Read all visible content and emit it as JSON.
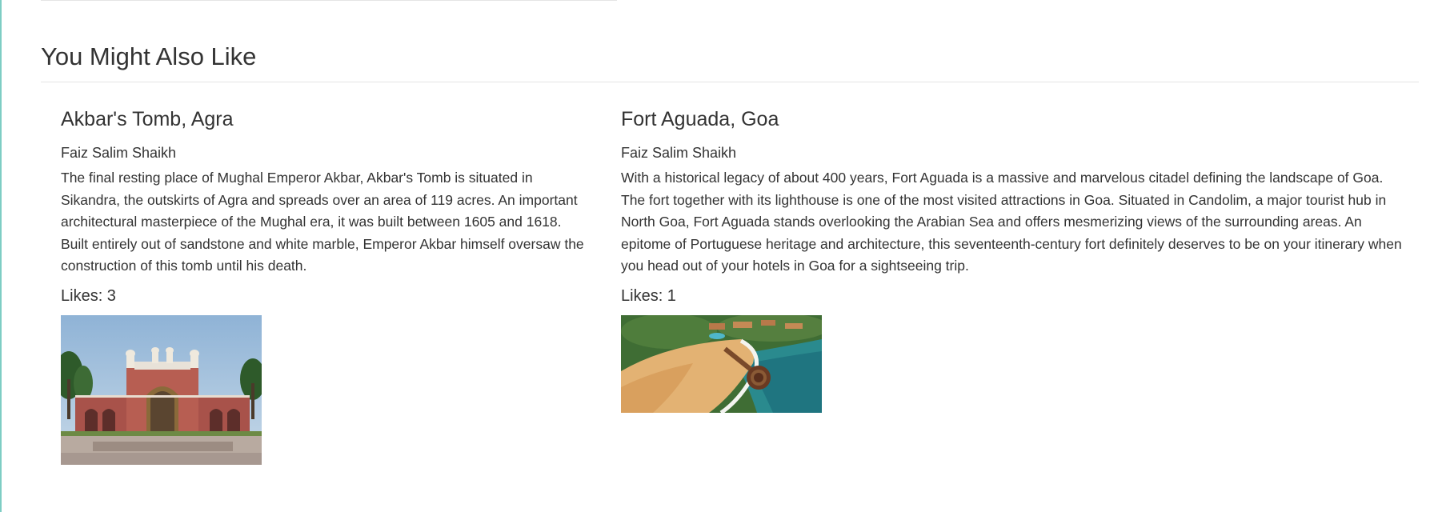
{
  "section": {
    "title": "You Might Also Like"
  },
  "cards": [
    {
      "title": "Akbar's Tomb, Agra",
      "author": "Faiz Salim Shaikh",
      "description": "The final resting place of Mughal Emperor Akbar, Akbar's Tomb is situated in Sikandra, the outskirts of Agra and spreads over an area of 119 acres. An important architectural masterpiece of the Mughal era, it was built between 1605 and 1618. Built entirely out of sandstone and white marble, Emperor Akbar himself oversaw the construction of this tomb until his death.",
      "likes": "Likes: 3",
      "image_icon": "tomb-photo"
    },
    {
      "title": "Fort Aguada, Goa",
      "author": "Faiz Salim Shaikh",
      "description": "With a historical legacy of about 400 years, Fort Aguada is a massive and marvelous citadel defining the landscape of Goa. The fort together with its lighthouse is one of the most visited attractions in Goa. Situated in Candolim, a major tourist hub in North Goa, Fort Aguada stands overlooking the Arabian Sea and offers mesmerizing views of the surrounding areas. An epitome of Portuguese heritage and architecture, this seventeenth-century fort definitely deserves to be on your itinerary when you head out of your hotels in Goa for a sightseeing trip.",
      "likes": "Likes: 1",
      "image_icon": "fort-photo"
    }
  ],
  "colors": {
    "text": "#333333",
    "rule": "#e5e5e5",
    "left_accent": "#7ecdc4"
  }
}
